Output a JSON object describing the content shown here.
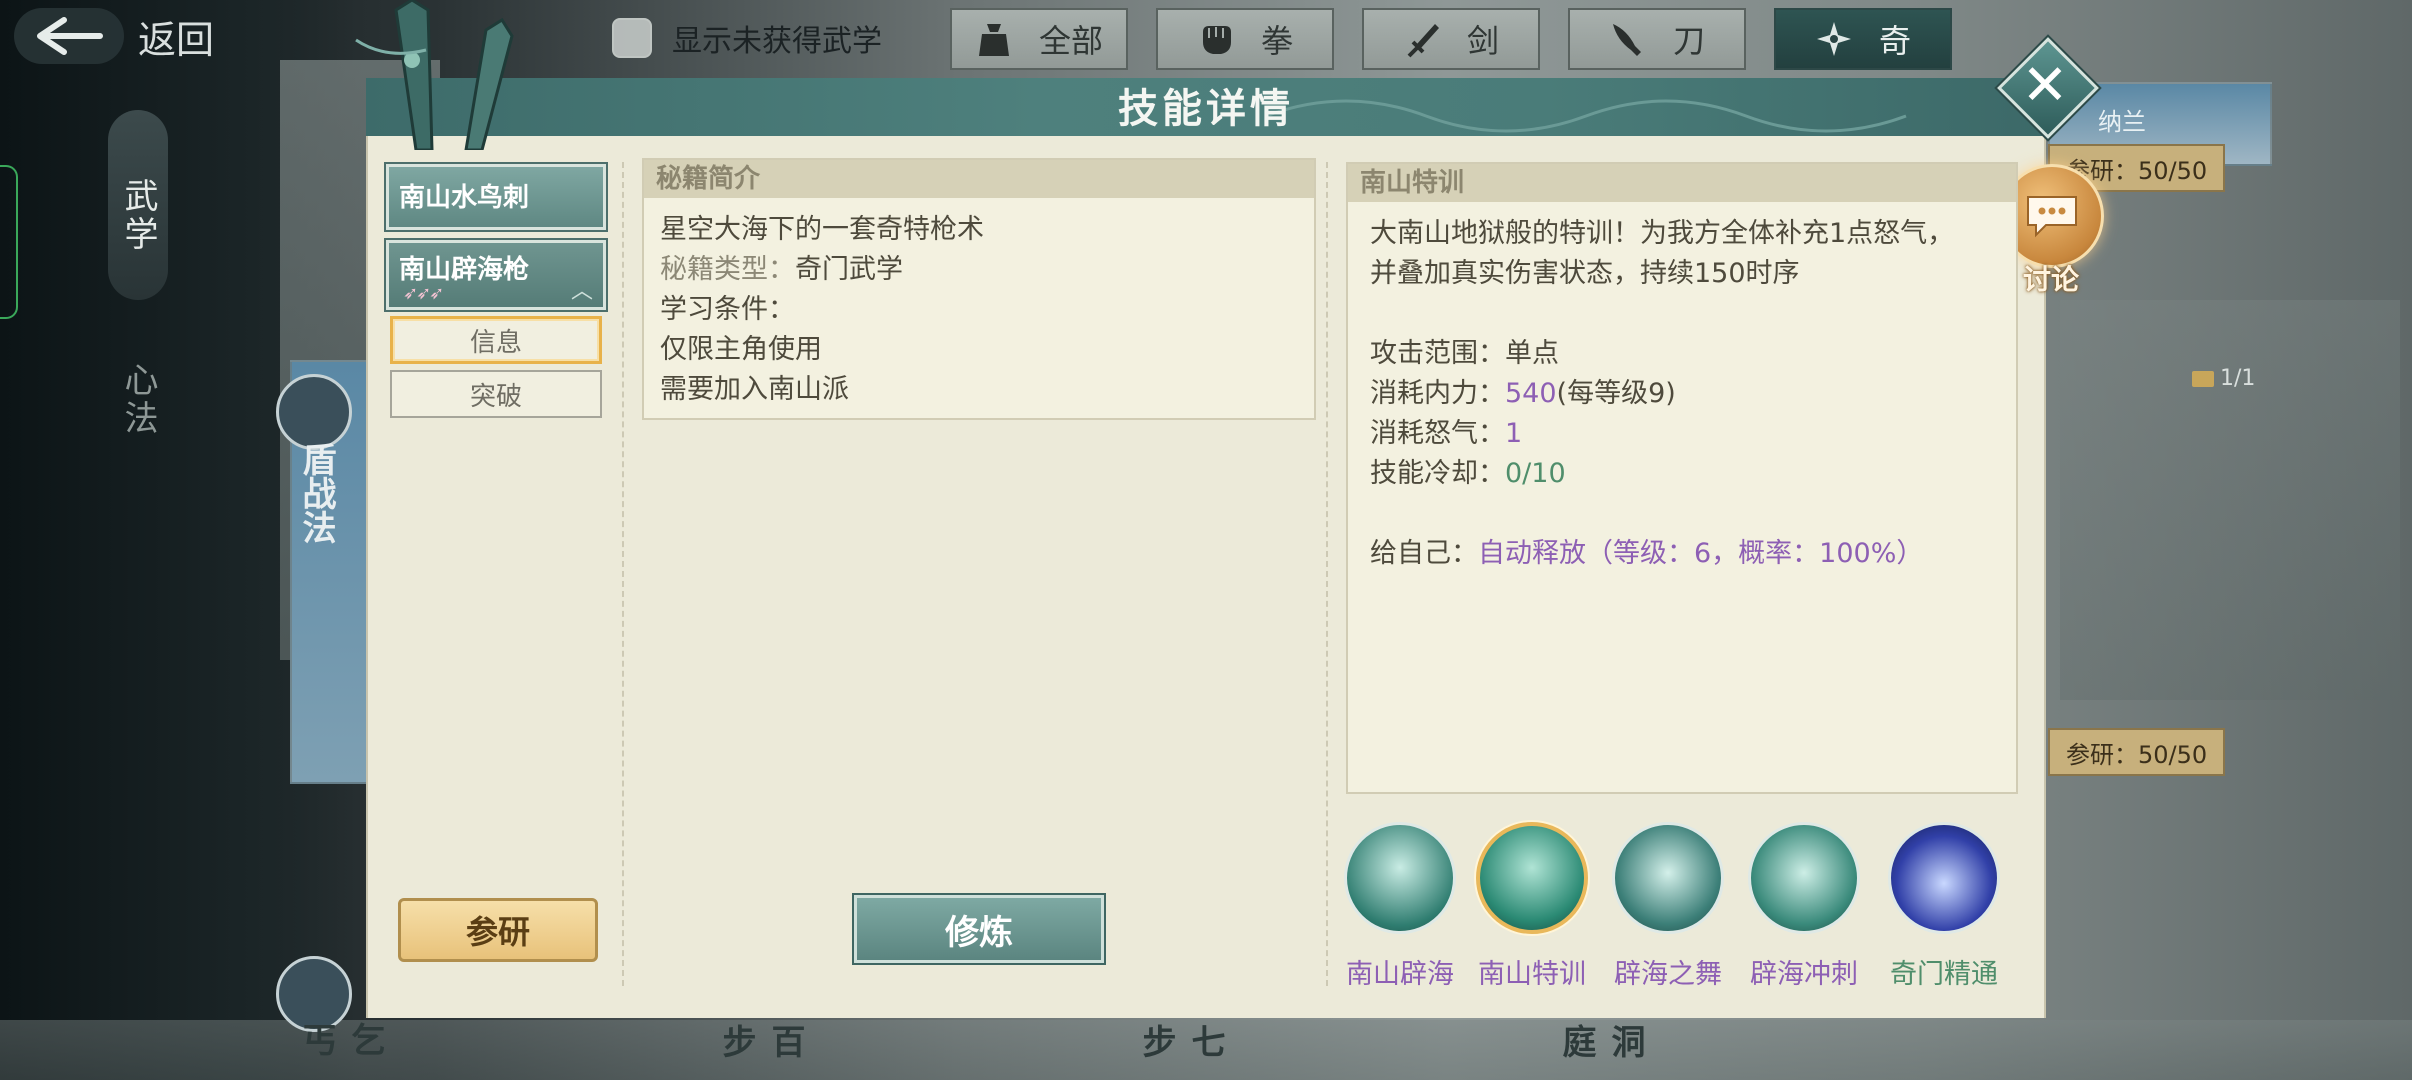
{
  "topbar": {
    "back_label": "返回",
    "toggle_label": "显示未获得武学",
    "filters": [
      {
        "label": "全部",
        "icon": "bag-icon"
      },
      {
        "label": "拳",
        "icon": "fist-icon"
      },
      {
        "label": "剑",
        "icon": "sword-icon"
      },
      {
        "label": "刀",
        "icon": "blade-icon"
      },
      {
        "label": "奇",
        "icon": "shuriken-icon"
      }
    ],
    "active_filter": "奇"
  },
  "side_menu": {
    "martial": "武学",
    "mind": "心法"
  },
  "background_cards": {
    "card1_title": "盾战法",
    "card2_title": "乞丐",
    "card3_title": "百步",
    "card4_title": "七步",
    "card5_title": "洞庭",
    "top_right_name": "纳兰",
    "research_top": "参研：50/50",
    "research_bottom": "参研：50/50",
    "book_count": "1/1"
  },
  "modal": {
    "title": "技能详情",
    "discuss_label": "讨论",
    "skills": [
      {
        "name": "南山水鸟刺"
      },
      {
        "name": "南山辟海枪",
        "arrows": "➶➶➶"
      }
    ],
    "sub_buttons": {
      "info": "信息",
      "breakthrough": "突破"
    },
    "research_button": "参研",
    "train_button": "修炼",
    "book_panel": {
      "header": "秘籍简介",
      "description": "星空大海下的一套奇特枪术",
      "type_label": "秘籍类型：",
      "type_value": "奇门武学",
      "condition_label": "学习条件：",
      "condition1": "仅限主角使用",
      "condition2": "需要加入南山派"
    },
    "skill_panel": {
      "header": "南山特训",
      "desc_line1": "大南山地狱般的特训！为我方全体补充1点怒气，",
      "desc_line2": "并叠加真实伤害状态，持续150时序",
      "range_label": "攻击范围：",
      "range_value": "单点",
      "mp_label": "消耗内力：",
      "mp_value": "540",
      "mp_suffix": "(每等级9)",
      "rage_label": "消耗怒气：",
      "rage_value": "1",
      "cd_label": "技能冷却：",
      "cd_value": "0/10",
      "self_label": "给自己：",
      "self_value": "自动释放（等级：6，概率：100%）"
    },
    "skill_icons": [
      {
        "label": "南山辟海",
        "color": "#8d5fb4"
      },
      {
        "label": "南山特训",
        "color": "#8d5fb4"
      },
      {
        "label": "辟海之舞",
        "color": "#8d5fb4"
      },
      {
        "label": "辟海冲刺",
        "color": "#8d5fb4"
      },
      {
        "label": "奇门精通",
        "color": "#4f8e6b"
      }
    ]
  }
}
